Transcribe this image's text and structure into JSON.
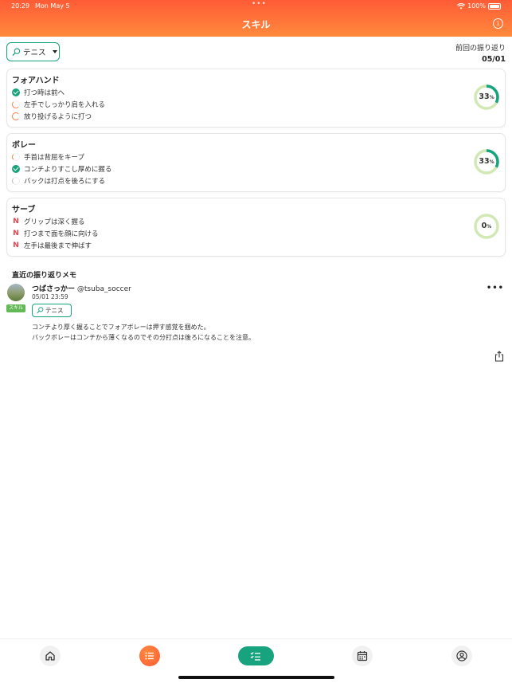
{
  "status_bar": {
    "time": "20:29",
    "date": "Mon May 5",
    "battery": "100%"
  },
  "header": {
    "title": "スキル"
  },
  "filter": {
    "label": "テニス"
  },
  "last_review": {
    "label": "前回の振り返り",
    "date": "05/01"
  },
  "skills": [
    {
      "title": "フォアハンド",
      "progress_pct": 33,
      "progress_label": "33",
      "items": [
        {
          "label": "打つ時は前へ",
          "status": "done"
        },
        {
          "label": "左手でしっかり肩を入れる",
          "status": "partial-2"
        },
        {
          "label": "放り投げるように打つ",
          "status": "partial-3"
        }
      ]
    },
    {
      "title": "ボレー",
      "progress_pct": 33,
      "progress_label": "33",
      "items": [
        {
          "label": "手首は背屈をキープ",
          "status": "partial-1"
        },
        {
          "label": "コンチよりすこし厚めに握る",
          "status": "done"
        },
        {
          "label": "バックは打点を後ろにする",
          "status": "partial-1-gray"
        }
      ]
    },
    {
      "title": "サーブ",
      "progress_pct": 0,
      "progress_label": "0",
      "items": [
        {
          "label": "グリップは深く握る",
          "status": "new"
        },
        {
          "label": "打つまで面を顔に向ける",
          "status": "new"
        },
        {
          "label": "左手は最後まで伸ばす",
          "status": "new"
        }
      ]
    }
  ],
  "percent_sign": "%",
  "new_mark": "N",
  "memo_section": {
    "title": "直近の振り返りメモ"
  },
  "memo": {
    "user_name": "つばさっかー",
    "user_handle": "@tsuba_soccer",
    "badge": "スキル",
    "datetime": "05/01 23:59",
    "tag": "テニス",
    "lines": [
      "コンチより厚く握ることでフォアボレーは押す感覚を掴めた。",
      "バックボレーはコンチから薄くなるのでその分打点は後ろになることを注意。"
    ],
    "menu": "•••"
  },
  "colors": {
    "accent": "#17a37d",
    "header_start": "#ff5b36",
    "header_end": "#ff8a3c",
    "warning": "#e8434b"
  },
  "icons": {
    "nav": [
      "home-icon",
      "list-icon",
      "checklist-icon",
      "calendar-icon",
      "user-icon"
    ]
  }
}
